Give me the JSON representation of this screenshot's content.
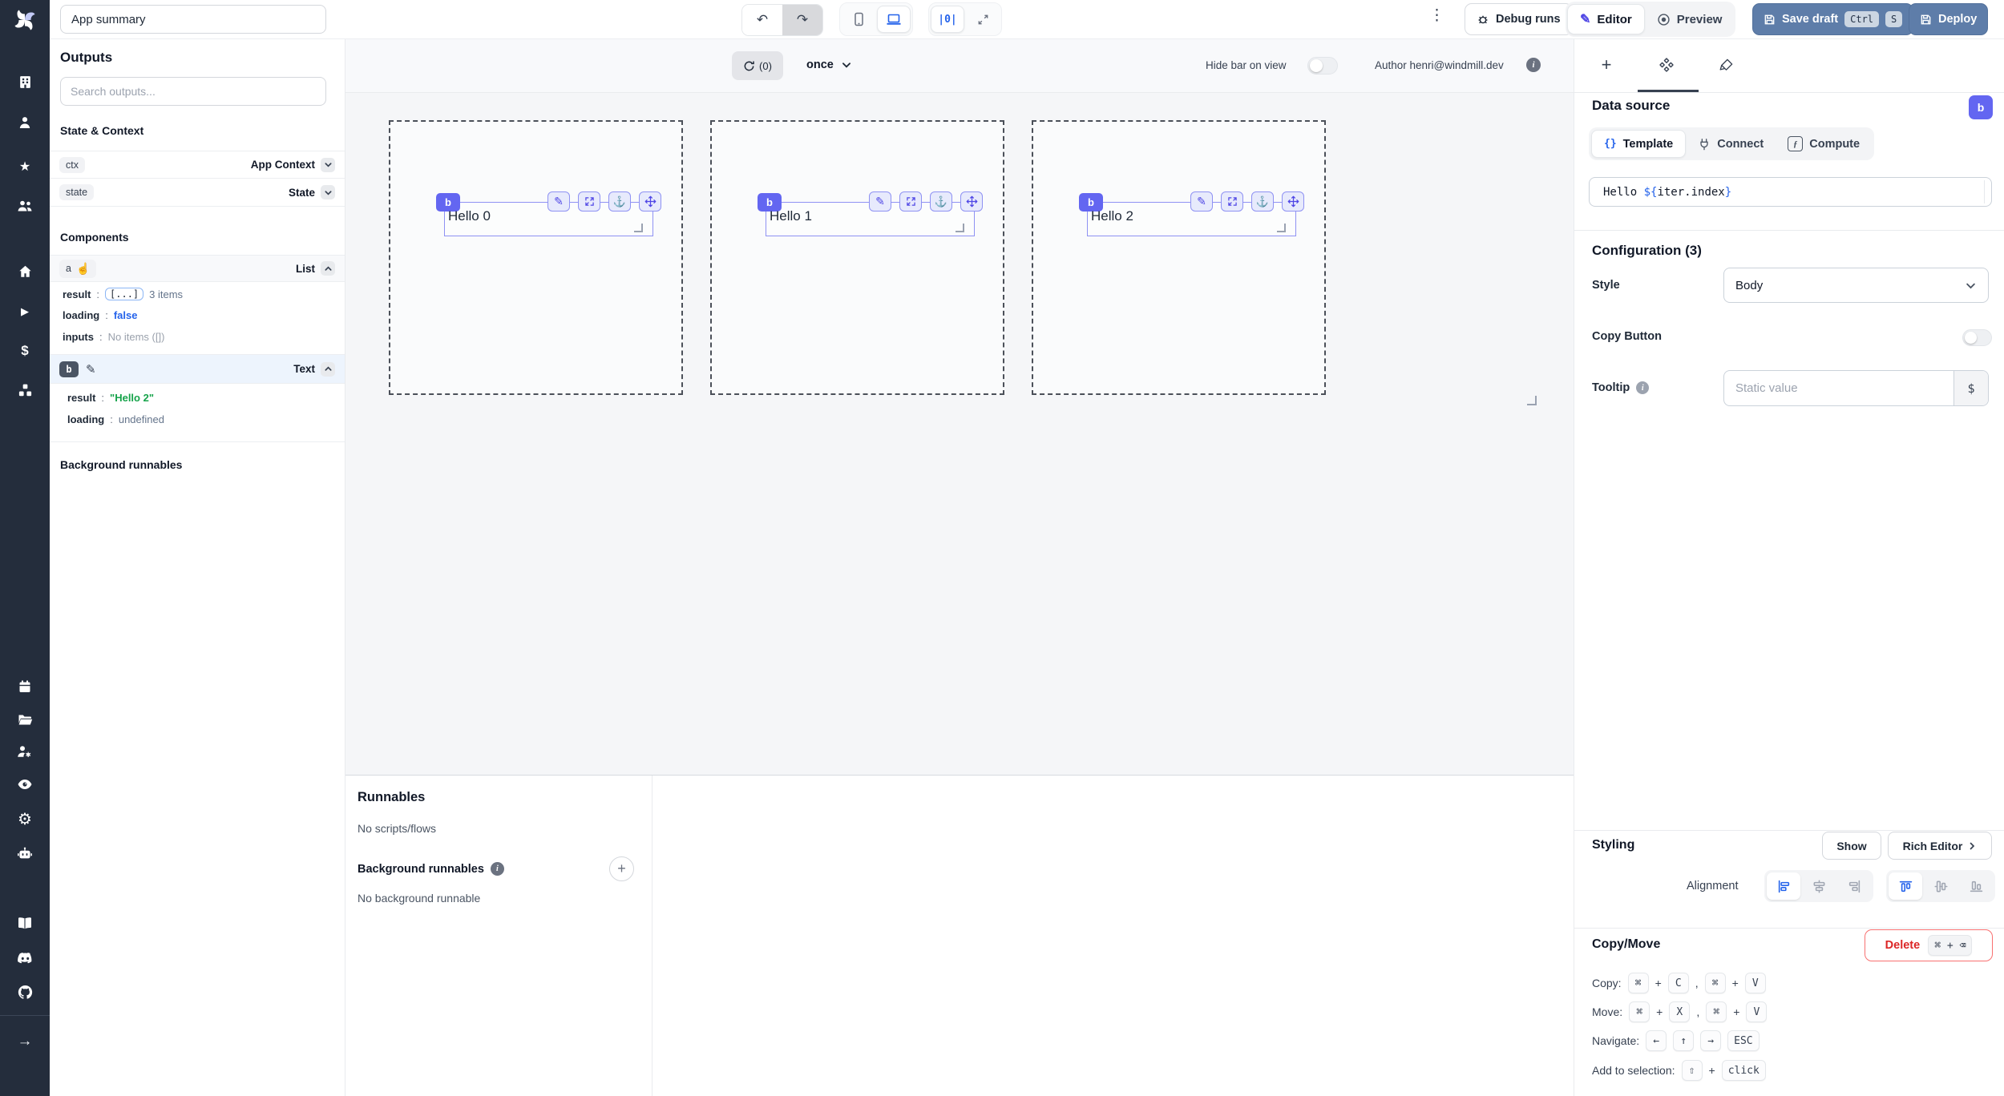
{
  "misc": {
    "colon": ":",
    "comma": ","
  },
  "icons": {
    "kebab": "⋮",
    "undo": "↶",
    "redo": "↷",
    "pencil": "✎",
    "anchor": "⚓",
    "hand": "☝",
    "gear": "⚙",
    "star": "★",
    "play": "▶",
    "dollar": "$",
    "arrow_right": "→",
    "plus": "+",
    "braces": "{}",
    "fn": "ƒ",
    "viewport_center": "|0|",
    "info": "i"
  },
  "rail": {
    "icon_names": [
      "building",
      "user",
      "star",
      "users",
      "home",
      "play",
      "dollar",
      "cubes",
      "calendar",
      "folder",
      "user-cog",
      "eye",
      "gear",
      "bot",
      "book",
      "discord",
      "github"
    ]
  },
  "header": {
    "app_name": "App summary",
    "debug_runs_label": "Debug runs",
    "editor_label": "Editor",
    "preview_label": "Preview",
    "save_draft_label": "Save draft",
    "save_kbd": [
      "Ctrl",
      "S"
    ],
    "deploy_label": "Deploy"
  },
  "sidebar": {
    "outputs_title": "Outputs",
    "search_placeholder": "Search outputs...",
    "state_context_title": "State & Context",
    "ctx_key": "ctx",
    "ctx_type": "App Context",
    "state_key": "state",
    "state_type": "State",
    "components_title": "Components",
    "list": {
      "id": "a",
      "type": "List",
      "result_key": "result",
      "result_pill": "[...]",
      "result_suffix": "3 items",
      "loading_key": "loading",
      "loading_value": "false",
      "inputs_key": "inputs",
      "inputs_value": "No items ([])"
    },
    "text": {
      "id": "b",
      "type": "Text",
      "result_key": "result",
      "result_value": "\"Hello 2\"",
      "loading_key": "loading",
      "loading_value": "undefined"
    },
    "background_title": "Background runnables"
  },
  "canvas": {
    "recompute_count": "(0)",
    "schedule": "once",
    "hide_bar_label": "Hide bar on view",
    "author_label": "Author henri@windmill.dev",
    "toolbar_icons": [
      "edit",
      "expand",
      "anchor",
      "move"
    ],
    "items": [
      {
        "id": "b",
        "label": "Hello 0"
      },
      {
        "id": "b",
        "label": "Hello 1"
      },
      {
        "id": "b",
        "label": "Hello 2"
      }
    ]
  },
  "runnables": {
    "title": "Runnables",
    "empty": "No scripts/flows",
    "background_title": "Background runnables",
    "background_empty": "No background runnable"
  },
  "right": {
    "datasource_title": "Data source",
    "badge": "b",
    "tabs": {
      "template": "Template",
      "connect": "Connect",
      "compute": "Compute"
    },
    "template_value": {
      "prefix": "Hello ",
      "open": "${",
      "expr": "iter.index",
      "close": "}"
    },
    "config_title": "Configuration (3)",
    "style_label": "Style",
    "style_value": "Body",
    "copy_button_label": "Copy Button",
    "tooltip_label": "Tooltip",
    "tooltip_placeholder": "Static value",
    "tooltip_connect": "$",
    "styling_title": "Styling",
    "show_label": "Show",
    "rich_editor_label": "Rich Editor",
    "alignment_label": "Alignment",
    "alignment_groups": [
      {
        "active": 0,
        "icons": [
          "align-left",
          "align-center-h",
          "align-right"
        ]
      },
      {
        "active": 0,
        "icons": [
          "align-top",
          "align-center-v",
          "align-bottom"
        ]
      }
    ],
    "copymove_title": "Copy/Move",
    "delete_label": "Delete",
    "delete_kbd": "⌘ + ⌫",
    "shortcut_rows": [
      {
        "label": "Copy:",
        "tokens": [
          {
            "k": "⌘"
          },
          {
            "t": "+"
          },
          {
            "k": "C"
          },
          {
            "t": ","
          },
          {
            "k": "⌘"
          },
          {
            "t": "+"
          },
          {
            "k": "V"
          }
        ]
      },
      {
        "label": "Move:",
        "tokens": [
          {
            "k": "⌘"
          },
          {
            "t": "+"
          },
          {
            "k": "X"
          },
          {
            "t": ","
          },
          {
            "k": "⌘"
          },
          {
            "t": "+"
          },
          {
            "k": "V"
          }
        ]
      },
      {
        "label": "Navigate:",
        "tokens": [
          {
            "k": "←"
          },
          {
            "k": "↑"
          },
          {
            "k": "→"
          },
          {
            "k": "ESC"
          }
        ]
      },
      {
        "label": "Add to selection:",
        "tokens": [
          {
            "k": "⇧"
          },
          {
            "t": "+"
          },
          {
            "k": "click"
          }
        ]
      }
    ]
  }
}
